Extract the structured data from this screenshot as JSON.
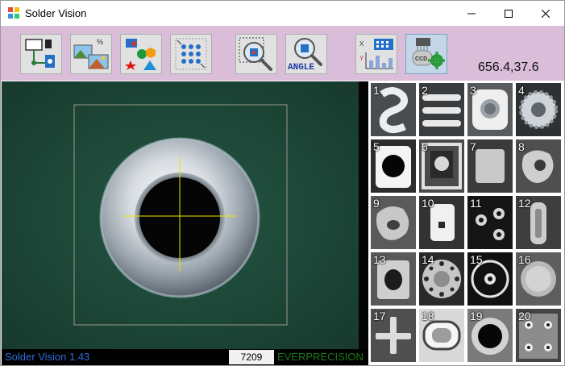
{
  "window": {
    "title": "Solder Vision",
    "controls": {
      "minimize": "—",
      "maximize": "☐",
      "close": "✕"
    }
  },
  "toolbar": {
    "tools": [
      {
        "name": "connect-camera-tool",
        "icon": "camera-connect-icon"
      },
      {
        "name": "image-adjust-tool",
        "icon": "landscape-percent-icon"
      },
      {
        "name": "shapes-tool",
        "icon": "shapes-icon"
      },
      {
        "name": "grid-points-tool",
        "icon": "dot-grid-icon"
      },
      {
        "name": "center-find-tool",
        "icon": "magnifier-center-icon"
      },
      {
        "name": "angle-tool",
        "icon": "magnifier-angle-icon",
        "label": "ANGLE"
      },
      {
        "name": "xy-chart-tool",
        "icon": "xy-chart-icon"
      },
      {
        "name": "ccd-settings-tool",
        "icon": "ccd-gear-icon",
        "label": "CCD"
      }
    ],
    "coordinates": "656.4,37.6"
  },
  "status": {
    "version": "Solder Vision  1.43",
    "count": "7209",
    "brand": "EVERPRECISION"
  },
  "thumbnails": [
    {
      "num": "1",
      "kind": "s-curve"
    },
    {
      "num": "2",
      "kind": "bars"
    },
    {
      "num": "3",
      "kind": "ring-square"
    },
    {
      "num": "4",
      "kind": "gear-ring"
    },
    {
      "num": "5",
      "kind": "white-box-hole"
    },
    {
      "num": "6",
      "kind": "framed-pad"
    },
    {
      "num": "7",
      "kind": "square-pad"
    },
    {
      "num": "8",
      "kind": "blob"
    },
    {
      "num": "9",
      "kind": "blob-selected"
    },
    {
      "num": "10",
      "kind": "rect-pad"
    },
    {
      "num": "11",
      "kind": "two-rings"
    },
    {
      "num": "12",
      "kind": "capsule"
    },
    {
      "num": "13",
      "kind": "rough-hole"
    },
    {
      "num": "14",
      "kind": "flange"
    },
    {
      "num": "15",
      "kind": "circle-outline"
    },
    {
      "num": "16",
      "kind": "gray-disc"
    },
    {
      "num": "17",
      "kind": "cross"
    },
    {
      "num": "18",
      "kind": "oval-slot"
    },
    {
      "num": "19",
      "kind": "big-ring"
    },
    {
      "num": "20",
      "kind": "four-holes"
    }
  ],
  "colors": {
    "toolbar_bg": "#d9bdd9",
    "board_green": "#1e4738",
    "crosshair": "#e6e600",
    "selected_outline": "#ffff00",
    "status_version": "#2f6dd8",
    "status_brand": "#197b19"
  }
}
